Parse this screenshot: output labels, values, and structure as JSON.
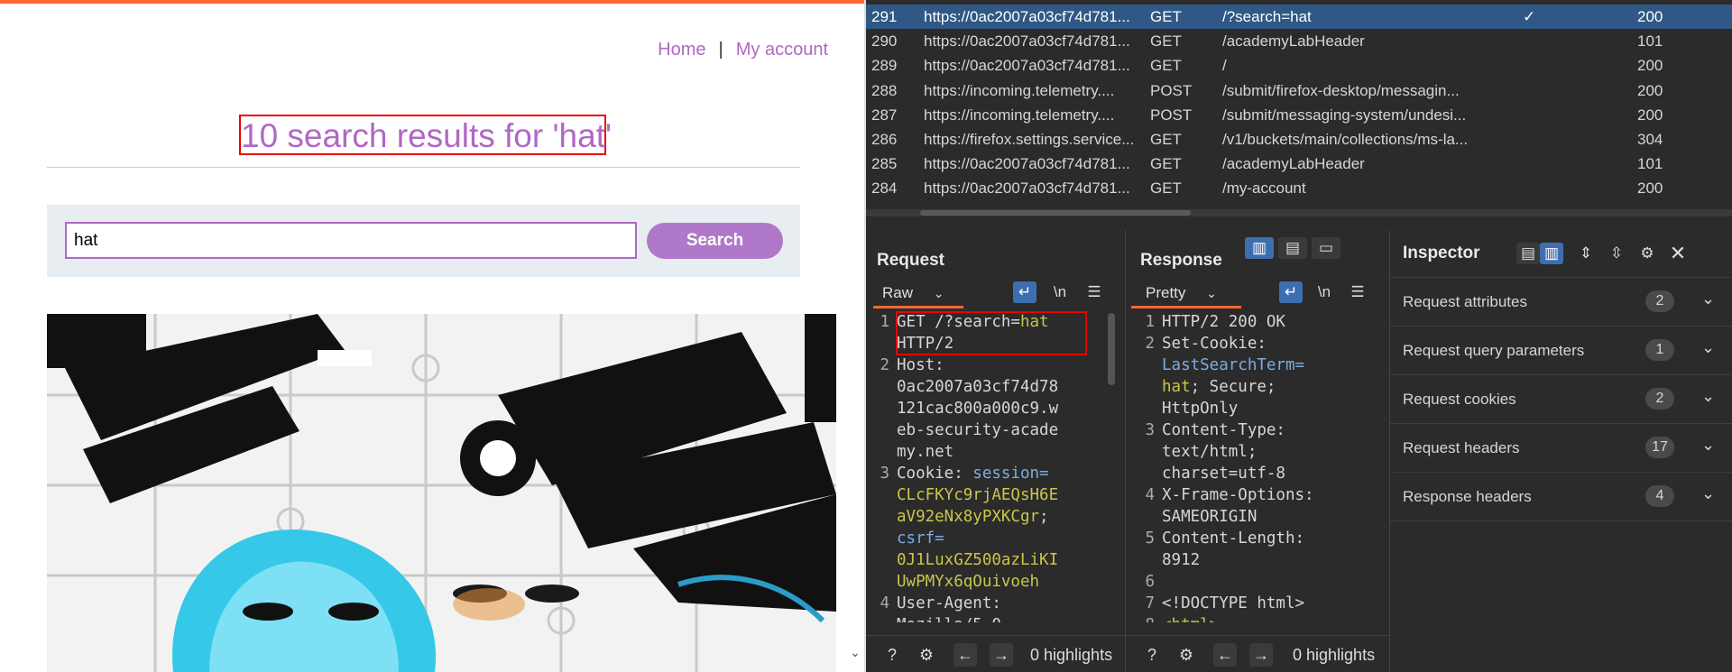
{
  "browser": {
    "nav": {
      "home": "Home",
      "separator": "|",
      "account": "My account"
    },
    "heading": "10 search results for 'hat'",
    "search": {
      "value": "hat",
      "button": "Search"
    }
  },
  "history": {
    "rows": [
      {
        "num": "291",
        "host": "https://0ac2007a03cf74d781...",
        "method": "GET",
        "url": "/?search=hat",
        "check": "✓",
        "status": "200",
        "selected": true
      },
      {
        "num": "290",
        "host": "https://0ac2007a03cf74d781...",
        "method": "GET",
        "url": "/academyLabHeader",
        "check": "",
        "status": "101"
      },
      {
        "num": "289",
        "host": "https://0ac2007a03cf74d781...",
        "method": "GET",
        "url": "/",
        "check": "",
        "status": "200"
      },
      {
        "num": "288",
        "host": "https://incoming.telemetry....",
        "method": "POST",
        "url": "/submit/firefox-desktop/messagin...",
        "check": "",
        "status": "200"
      },
      {
        "num": "287",
        "host": "https://incoming.telemetry....",
        "method": "POST",
        "url": "/submit/messaging-system/undesi...",
        "check": "",
        "status": "200"
      },
      {
        "num": "286",
        "host": "https://firefox.settings.service...",
        "method": "GET",
        "url": "/v1/buckets/main/collections/ms-la...",
        "check": "",
        "status": "304"
      },
      {
        "num": "285",
        "host": "https://0ac2007a03cf74d781...",
        "method": "GET",
        "url": "/academyLabHeader",
        "check": "",
        "status": "101"
      },
      {
        "num": "284",
        "host": "https://0ac2007a03cf74d781...",
        "method": "GET",
        "url": "/my-account",
        "check": "",
        "status": "200"
      }
    ]
  },
  "request": {
    "title": "Request",
    "view": "Raw",
    "newline_icon": "\\n",
    "highlights": "0 highlights",
    "lines": [
      {
        "n": "1",
        "parts": [
          [
            "",
            "GET /?search="
          ],
          [
            "v",
            "hat"
          ]
        ]
      },
      {
        "n": "",
        "parts": [
          [
            "",
            "HTTP/2"
          ]
        ]
      },
      {
        "n": "2",
        "parts": [
          [
            "",
            "Host:"
          ]
        ]
      },
      {
        "n": "",
        "parts": [
          [
            "",
            "0ac2007a03cf74d78"
          ]
        ]
      },
      {
        "n": "",
        "parts": [
          [
            "",
            "121cac800a000c9.w"
          ]
        ]
      },
      {
        "n": "",
        "parts": [
          [
            "",
            "eb-security-acade"
          ]
        ]
      },
      {
        "n": "",
        "parts": [
          [
            "",
            "my.net"
          ]
        ]
      },
      {
        "n": "3",
        "parts": [
          [
            "",
            "Cookie: "
          ],
          [
            "k",
            "session="
          ]
        ]
      },
      {
        "n": "",
        "parts": [
          [
            "v",
            "CLcFKYc9rjAEQsH6E"
          ]
        ]
      },
      {
        "n": "",
        "parts": [
          [
            "v",
            "aV92eNx8yPXKCgr"
          ],
          [
            "",
            ";"
          ]
        ]
      },
      {
        "n": "",
        "parts": [
          [
            "k",
            "csrf="
          ]
        ]
      },
      {
        "n": "",
        "parts": [
          [
            "v",
            "0J1LuxGZ500azLiKI"
          ]
        ]
      },
      {
        "n": "",
        "parts": [
          [
            "v",
            "UwPMYx6qOuivoeh"
          ]
        ]
      },
      {
        "n": "4",
        "parts": [
          [
            "",
            "User-Agent:"
          ]
        ]
      },
      {
        "n": "",
        "parts": [
          [
            "",
            "Mozilla/5.0"
          ]
        ]
      }
    ]
  },
  "response": {
    "title": "Response",
    "view": "Pretty",
    "newline_icon": "\\n",
    "highlights": "0 highlights",
    "lines": [
      {
        "n": "1",
        "parts": [
          [
            "",
            "HTTP/2 200 OK"
          ]
        ]
      },
      {
        "n": "2",
        "parts": [
          [
            "",
            "Set-Cookie:"
          ]
        ]
      },
      {
        "n": "",
        "parts": [
          [
            "k",
            "LastSearchTerm="
          ]
        ]
      },
      {
        "n": "",
        "parts": [
          [
            "v",
            "hat"
          ],
          [
            "",
            "; Secure;"
          ]
        ]
      },
      {
        "n": "",
        "parts": [
          [
            "",
            "HttpOnly"
          ]
        ]
      },
      {
        "n": "3",
        "parts": [
          [
            "",
            "Content-Type:"
          ]
        ]
      },
      {
        "n": "",
        "parts": [
          [
            "",
            "text/html;"
          ]
        ]
      },
      {
        "n": "",
        "parts": [
          [
            "",
            "charset=utf-8"
          ]
        ]
      },
      {
        "n": "4",
        "parts": [
          [
            "",
            "X-Frame-Options:"
          ]
        ]
      },
      {
        "n": "",
        "parts": [
          [
            "",
            "SAMEORIGIN"
          ]
        ]
      },
      {
        "n": "5",
        "parts": [
          [
            "",
            "Content-Length:"
          ]
        ]
      },
      {
        "n": "",
        "parts": [
          [
            "",
            "8912"
          ]
        ]
      },
      {
        "n": "6",
        "parts": [
          [
            "",
            ""
          ]
        ]
      },
      {
        "n": "7",
        "parts": [
          [
            "",
            "<!DOCTYPE html>"
          ]
        ]
      },
      {
        "n": "8",
        "parts": [
          [
            "v",
            "<html>"
          ]
        ]
      }
    ]
  },
  "inspector": {
    "title": "Inspector",
    "rows": [
      {
        "label": "Request attributes",
        "count": "2"
      },
      {
        "label": "Request query parameters",
        "count": "1"
      },
      {
        "label": "Request cookies",
        "count": "2"
      },
      {
        "label": "Request headers",
        "count": "17"
      },
      {
        "label": "Response headers",
        "count": "4"
      }
    ]
  }
}
